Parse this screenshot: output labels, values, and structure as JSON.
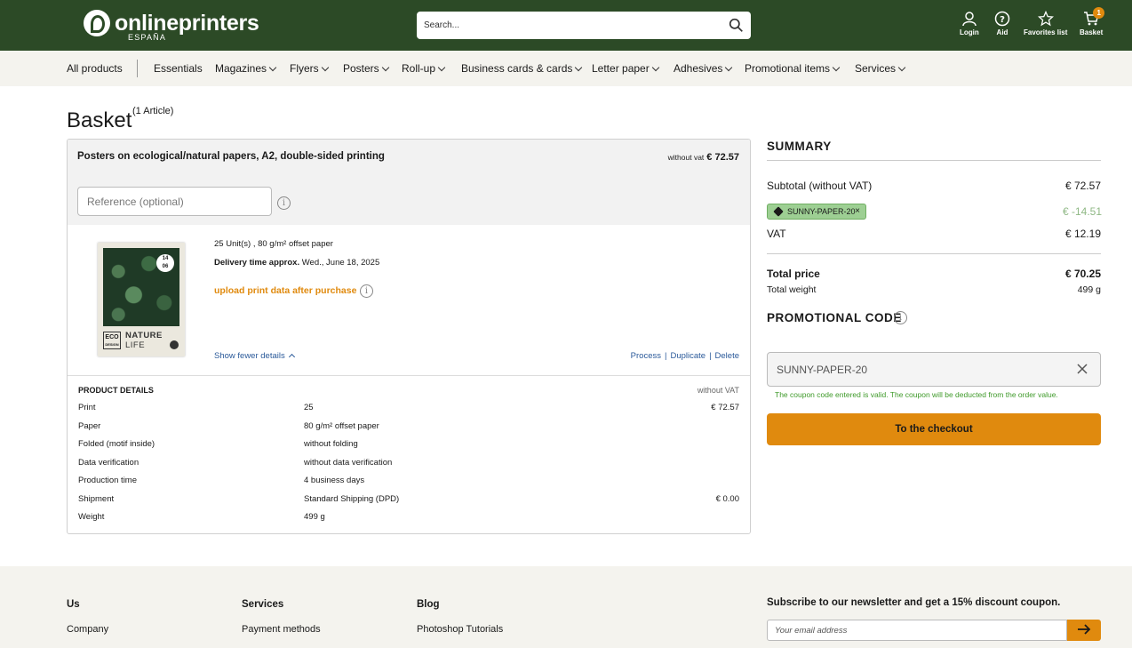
{
  "header": {
    "logo_text": "onlineprinters",
    "logo_sub": "ESPAÑA",
    "search_placeholder": "Search...",
    "login": "Login",
    "aid": "Aid",
    "favorites": "Favorites list",
    "basket": "Basket",
    "basket_count": "1"
  },
  "nav": {
    "items": [
      "All products",
      "Essentials",
      "Magazines",
      "Flyers",
      "Posters",
      "Roll-up",
      "Business cards & cards",
      "Letter paper",
      "Adhesives",
      "Promotional items",
      "Services"
    ]
  },
  "basket": {
    "title": "Basket",
    "article_count": "(1 Article)",
    "item": {
      "title": "Posters on ecological/natural papers, A2, double-sided printing",
      "without_vat_label": "without vat",
      "price": "€ 72.57",
      "reference_placeholder": "Reference (optional)",
      "units": "25 Unit(s) , 80 g/m² offset paper",
      "delivery_label": "Delivery time approx.",
      "delivery_value": "Wed., June 18, 2025",
      "upload": "upload print data after purchase",
      "show_fewer": "Show fewer details",
      "process": "Process",
      "duplicate": "Duplicate",
      "delete": "Delete",
      "thumb_date_top": "14",
      "thumb_date_bottom": "06",
      "thumb_eco": "ECO",
      "thumb_eco_sub": "DESIGN",
      "thumb_title_1": "NATURE",
      "thumb_title_2": "LIFE"
    },
    "details": {
      "header": "PRODUCT DETAILS",
      "without_vat": "without VAT",
      "rows": [
        {
          "key": "Print",
          "value": "25",
          "price": "€ 72.57"
        },
        {
          "key": "Paper",
          "value": "80 g/m² offset paper",
          "price": ""
        },
        {
          "key": "Folded (motif inside)",
          "value": "without folding",
          "price": ""
        },
        {
          "key": "Data verification",
          "value": "without data verification",
          "price": ""
        },
        {
          "key": "Production time",
          "value": "4 business days",
          "price": ""
        },
        {
          "key": "Shipment",
          "value": "Standard Shipping (DPD)",
          "price": "€ 0.00"
        },
        {
          "key": "Weight",
          "value": "499 g",
          "price": ""
        }
      ]
    }
  },
  "summary": {
    "title": "SUMMARY",
    "subtotal_label": "Subtotal (without VAT)",
    "subtotal": "€ 72.57",
    "coupon_code": "SUNNY-PAPER-20",
    "coupon_value": "€ -14.51",
    "vat_label": "VAT",
    "vat": "€ 12.19",
    "total_label": "Total price",
    "total": "€ 70.25",
    "weight_label": "Total weight",
    "weight": "499 g",
    "promo_title": "PROMOTIONAL CODE",
    "promo_value": "SUNNY-PAPER-20",
    "promo_message": "The coupon code entered is valid. The coupon will be deducted from the order value.",
    "checkout": "To the checkout"
  },
  "footer": {
    "cols": [
      {
        "head": "Us",
        "item": "Company"
      },
      {
        "head": "Services",
        "item": "Payment methods"
      },
      {
        "head": "Blog",
        "item": "Photoshop Tutorials"
      }
    ],
    "newsletter_title": "Subscribe to our newsletter and get a 15% discount coupon.",
    "email_placeholder": "Your email address"
  },
  "colors": {
    "header_bg": "#2c4a26",
    "accent": "#e08a0e",
    "link": "#2b5a9a",
    "success": "#3f9a2a"
  }
}
